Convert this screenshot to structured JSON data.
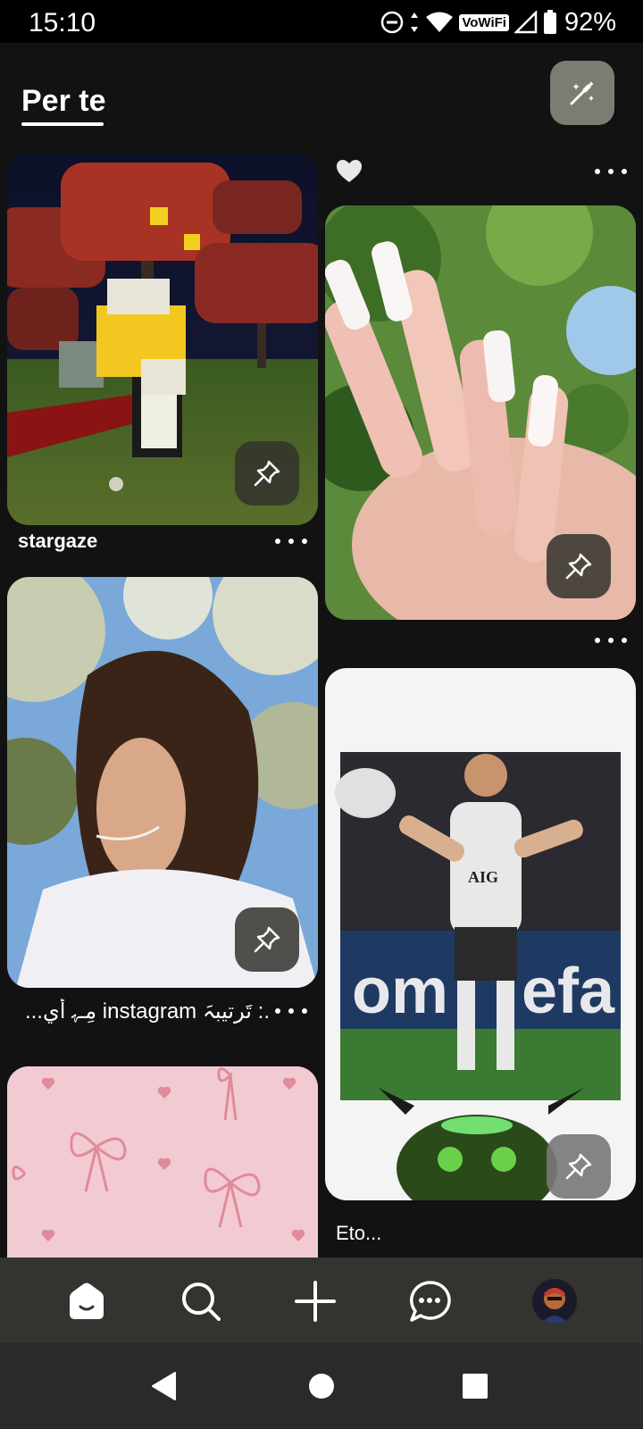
{
  "status_bar": {
    "time": "15:10",
    "network_label": "VoWiFi",
    "battery": "92%",
    "icons": [
      "do-not-disturb-icon",
      "data-arrows-icon",
      "wifi-icon",
      "signal-icon",
      "battery-icon"
    ]
  },
  "header": {
    "tab_label": "Per te",
    "magic_button_icon": "magic-wand-icon"
  },
  "feed": {
    "pins": [
      {
        "id": "top-partial",
        "caption": "",
        "has_heart": true
      },
      {
        "id": "roblox",
        "caption": "stargaze"
      },
      {
        "id": "nails",
        "caption": ""
      },
      {
        "id": "girl",
        "caption": ".: تَرتيبہَ instagram مِـﮩ أيِ..."
      },
      {
        "id": "football",
        "caption": "Eto..."
      },
      {
        "id": "bows",
        "caption": ""
      }
    ]
  },
  "bottom_nav": {
    "items": [
      "home-icon",
      "search-icon",
      "create-icon",
      "messages-icon",
      "profile-avatar"
    ]
  },
  "colors": {
    "background": "#121212",
    "nav_bar": "#33332f",
    "magic_button": "#7c7c72"
  }
}
